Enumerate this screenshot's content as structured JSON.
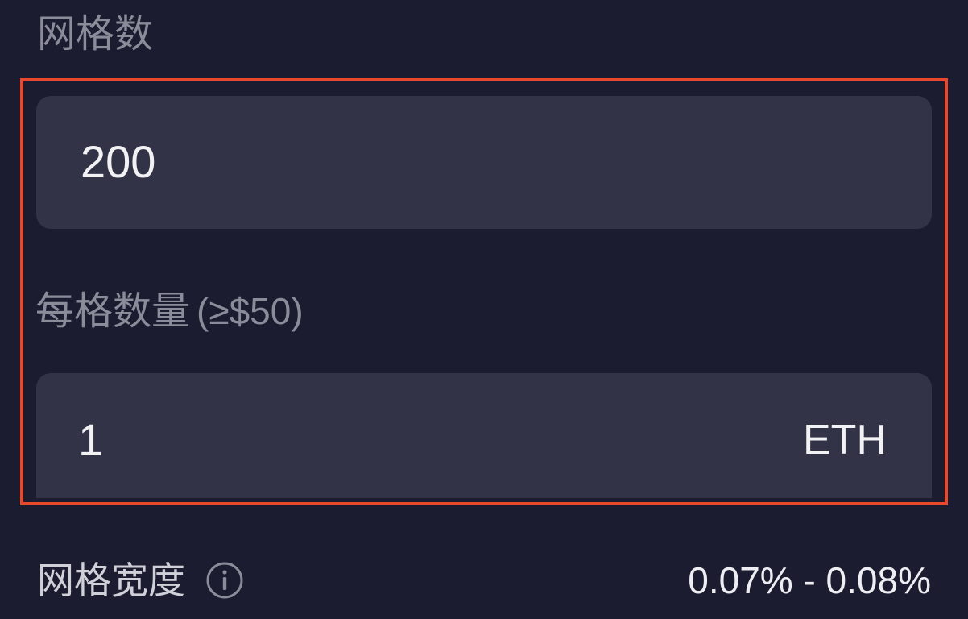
{
  "grid_count": {
    "label": "网格数",
    "value": "200"
  },
  "qty_per_grid": {
    "label": "每格数量",
    "hint": "(≥$50)",
    "value": "1",
    "unit": "ETH"
  },
  "grid_width": {
    "label": "网格宽度",
    "info_icon": "info-icon",
    "value": "0.07% - 0.08%"
  },
  "colors": {
    "background": "#1b1c30",
    "input_background": "#323347",
    "highlight_border": "#e9482a",
    "label_text": "#8b8c9a",
    "value_text": "#f2f2f5"
  }
}
